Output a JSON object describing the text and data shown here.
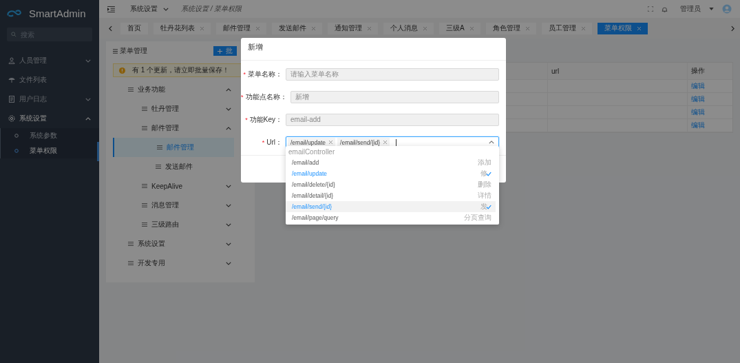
{
  "sidebar": {
    "brand": "SmartAdmin",
    "search": {
      "placeholder": "搜索"
    },
    "items": [
      {
        "label": "人员管理",
        "expanded": false
      },
      {
        "label": "文件列表"
      },
      {
        "label": "用户日志",
        "expanded": false
      },
      {
        "label": "系统设置",
        "expanded": true,
        "children": [
          {
            "label": "系统参数",
            "selected": false
          },
          {
            "label": "菜单权限",
            "selected": true
          }
        ]
      }
    ]
  },
  "header": {
    "menu_title": "系统设置",
    "breadcrumb": "系统设置 / 菜单权限",
    "user": "管理员"
  },
  "tabs": [
    {
      "label": "首页",
      "closable": false,
      "selected": false
    },
    {
      "label": "牡丹花列表",
      "closable": true,
      "selected": false
    },
    {
      "label": "邮件管理",
      "closable": true,
      "selected": false
    },
    {
      "label": "发送邮件",
      "closable": true,
      "selected": false
    },
    {
      "label": "通知管理",
      "closable": true,
      "selected": false
    },
    {
      "label": "个人消息",
      "closable": true,
      "selected": false
    },
    {
      "label": "三级A",
      "closable": true,
      "selected": false
    },
    {
      "label": "角色管理",
      "closable": true,
      "selected": false
    },
    {
      "label": "员工管理",
      "closable": true,
      "selected": false
    },
    {
      "label": "菜单权限",
      "closable": true,
      "selected": true
    }
  ],
  "menu_panel": {
    "title": "菜单管理",
    "button": "批",
    "alert": "有 1 个更新，请立即批量保存！",
    "tree": [
      {
        "label": "业务功能",
        "expanded": true,
        "selected": false,
        "children": [
          {
            "label": "牡丹管理",
            "expanded": false,
            "selected": false
          },
          {
            "label": "邮件管理",
            "expanded": true,
            "selected": false,
            "children": [
              {
                "label": "邮件管理",
                "selected": true
              },
              {
                "label": "发送邮件",
                "selected": false
              }
            ]
          },
          {
            "label": "KeepAlive",
            "expanded": false,
            "selected": false
          },
          {
            "label": "消息管理",
            "expanded": false,
            "selected": false
          },
          {
            "label": "三级路由",
            "expanded": false,
            "selected": false
          }
        ]
      },
      {
        "label": "系统设置",
        "expanded": false,
        "selected": false
      },
      {
        "label": "开发专用",
        "expanded": false,
        "selected": false
      }
    ]
  },
  "table": {
    "columns": [
      "url",
      "操作"
    ],
    "rows": [
      {
        "action": "编辑"
      },
      {
        "action": "编辑"
      },
      {
        "action": "编辑"
      },
      {
        "action": "编辑"
      }
    ]
  },
  "dialog": {
    "title": "新增",
    "fields": [
      {
        "kind": "text",
        "mark": "*",
        "label": "菜单名称：",
        "disabled": true,
        "placeholder": "请输入菜单名称"
      },
      {
        "kind": "text",
        "mark": "*",
        "label": "功能点名称：",
        "disabled": true,
        "value": "新增"
      },
      {
        "kind": "text",
        "mark": "*",
        "label": "功能Key：",
        "disabled": true,
        "value": "email-add"
      },
      {
        "kind": "multiselect",
        "mark": "*",
        "label": "Url：",
        "tags": [
          "/email/update",
          "/email/send/{id}"
        ]
      }
    ],
    "dropdown": {
      "group": "emailController",
      "options": [
        {
          "path": "/email/add",
          "label": "添加",
          "selected": false,
          "hovered": false
        },
        {
          "path": "/email/update",
          "label": "修",
          "selected": true,
          "hovered": false
        },
        {
          "path": "/email/delete/{id}",
          "label": "删除",
          "selected": false,
          "hovered": false
        },
        {
          "path": "/email/detail/{id}",
          "label": "详情",
          "selected": false,
          "hovered": false
        },
        {
          "path": "/email/send/{id}",
          "label": "发",
          "selected": true,
          "hovered": true
        },
        {
          "path": "/email/page/query",
          "label": "分页查询",
          "selected": false,
          "hovered": false
        }
      ]
    }
  }
}
